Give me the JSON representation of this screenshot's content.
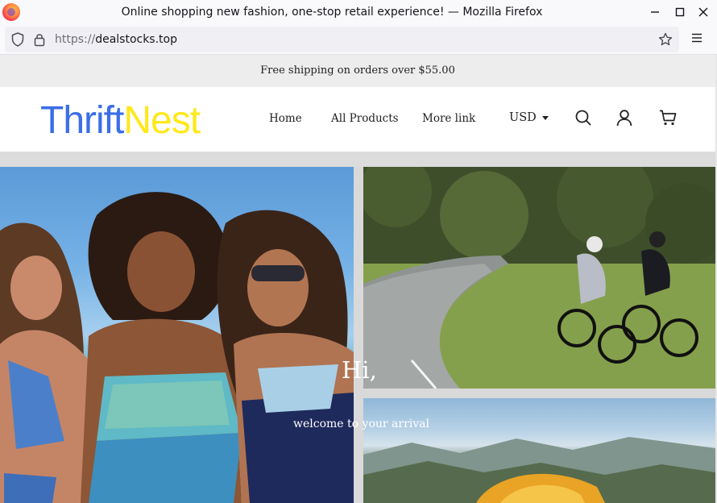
{
  "browser": {
    "window_title": "Online shopping new fashion, one-stop retail experience! — Mozilla Firefox",
    "url_protocol": "https://",
    "url_host": "dealstocks.top",
    "buttons": {
      "minimize": "—",
      "maximize": "☐",
      "close": "✕"
    }
  },
  "page": {
    "promo_text": "Free shipping on orders over $55.00",
    "logo": {
      "part1": "Thrift",
      "part2": "Nest"
    },
    "nav": [
      "Home",
      "All Products",
      "More link"
    ],
    "currency": "USD",
    "header_icons": [
      "search-icon",
      "account-icon",
      "cart-icon"
    ],
    "hero": {
      "title": "Hi,",
      "subtitle": "welcome to your arrival"
    }
  },
  "colors": {
    "logo_blue": "#3b6ee6",
    "logo_yellow": "#ffe81a",
    "promo_bg": "#ededed"
  }
}
